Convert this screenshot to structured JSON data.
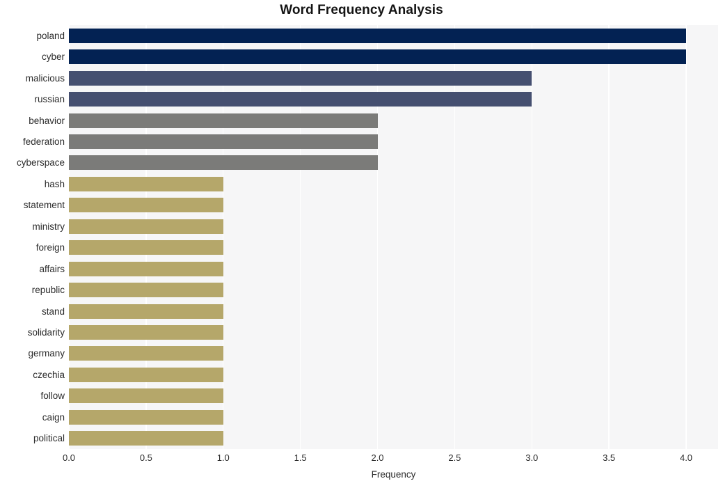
{
  "chart_data": {
    "type": "bar",
    "orientation": "horizontal",
    "title": "Word Frequency Analysis",
    "xlabel": "Frequency",
    "ylabel": "",
    "xlim": [
      0.0,
      4.0
    ],
    "xticks": [
      "0.0",
      "0.5",
      "1.0",
      "1.5",
      "2.0",
      "2.5",
      "3.0",
      "3.5",
      "4.0"
    ],
    "xtick_values": [
      0.0,
      0.5,
      1.0,
      1.5,
      2.0,
      2.5,
      3.0,
      3.5,
      4.0
    ],
    "grid": true,
    "grid_axis": "both",
    "legend": "none",
    "categories": [
      "poland",
      "cyber",
      "malicious",
      "russian",
      "behavior",
      "federation",
      "cyberspace",
      "hash",
      "statement",
      "ministry",
      "foreign",
      "affairs",
      "republic",
      "stand",
      "solidarity",
      "germany",
      "czechia",
      "follow",
      "caign",
      "political"
    ],
    "values": [
      4,
      4,
      3,
      3,
      2,
      2,
      2,
      1,
      1,
      1,
      1,
      1,
      1,
      1,
      1,
      1,
      1,
      1,
      1,
      1
    ],
    "bar_colors": [
      "#032253",
      "#032253",
      "#454f70",
      "#454f70",
      "#7b7b79",
      "#7b7b79",
      "#7b7b79",
      "#b5a76a",
      "#b5a76a",
      "#b5a76a",
      "#b5a76a",
      "#b5a76a",
      "#b5a76a",
      "#b5a76a",
      "#b5a76a",
      "#b5a76a",
      "#b5a76a",
      "#b5a76a",
      "#b5a76a",
      "#b5a76a"
    ],
    "palette": {
      "navy": "#032253",
      "slate": "#454f70",
      "gray": "#7b7b79",
      "khaki": "#b5a76a"
    },
    "plot_background": "#f6f6f7",
    "gridline_color": "#ffffff",
    "figure_background": "#ffffff",
    "text_color": "#2b2b2b"
  }
}
